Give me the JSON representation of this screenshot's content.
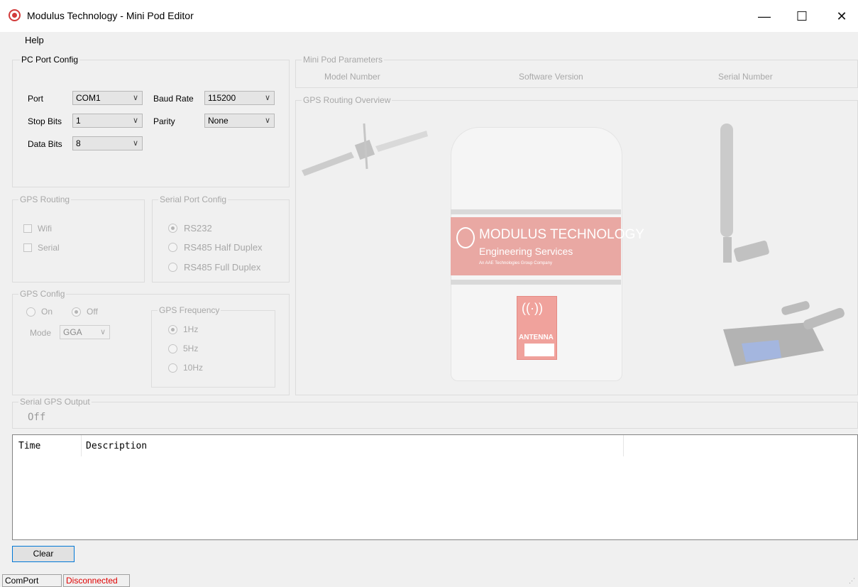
{
  "window": {
    "title": "Modulus Technology - Mini Pod Editor",
    "min": "—",
    "max": "☐",
    "close": "✕"
  },
  "menu": {
    "help": "Help"
  },
  "pc_port_config": {
    "title": "PC Port Config",
    "port_label": "Port",
    "port_value": "COM1",
    "baud_label": "Baud Rate",
    "baud_value": "115200",
    "stop_label": "Stop Bits",
    "stop_value": "1",
    "parity_label": "Parity",
    "parity_value": "None",
    "data_label": "Data Bits",
    "data_value": "8"
  },
  "gps_routing": {
    "title": "GPS Routing",
    "wifi": "Wifi",
    "serial": "Serial"
  },
  "serial_port_config": {
    "title": "Serial Port Config",
    "rs232": "RS232",
    "rs485_half": "RS485 Half Duplex",
    "rs485_full": "RS485 Full Duplex",
    "selected": "RS232"
  },
  "gps_config": {
    "title": "GPS Config",
    "on": "On",
    "off": "Off",
    "mode_label": "Mode",
    "mode_value": "GGA"
  },
  "gps_frequency": {
    "title": "GPS Frequency",
    "f1": "1Hz",
    "f5": "5Hz",
    "f10": "10Hz",
    "selected": "1Hz"
  },
  "serial_gps_output": {
    "title": "Serial GPS Output",
    "value": "Off"
  },
  "mini_pod_parameters": {
    "title": "Mini Pod Parameters",
    "model": "Model Number",
    "software": "Software Version",
    "serial": "Serial Number"
  },
  "gps_routing_overview": {
    "title": "GPS Routing Overview",
    "pod_brand": "MODULUS TECHNOLOGY",
    "pod_subtitle": "Engineering Services",
    "pod_tagline": "An AAE Technologies Group Company",
    "antenna_label": "ANTENNA",
    "icons": [
      "satellite-icon",
      "antenna-icon",
      "serial-connector-icon"
    ]
  },
  "log": {
    "columns": [
      "Time",
      "Description"
    ]
  },
  "buttons": {
    "clear": "Clear"
  },
  "status": {
    "comport": "ComPort",
    "connection": "Disconnected",
    "connection_color": "#e00000"
  }
}
